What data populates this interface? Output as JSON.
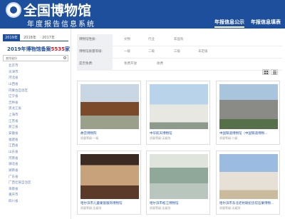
{
  "header": {
    "title": "全国博物馆",
    "subtitle": "年度报告信息系统",
    "tabs": [
      {
        "label": "年报信息公示",
        "active": true
      },
      {
        "label": "年报信息填表",
        "active": false
      }
    ],
    "colors": {
      "brand": "#1e4f9c"
    }
  },
  "sidebar": {
    "year_tabs": [
      {
        "label": "2019年",
        "active": true
      },
      {
        "label": "2018年",
        "active": false
      },
      {
        "label": "2017年",
        "active": false
      }
    ],
    "count_prefix": "2019年博物馆备案",
    "count": "5535",
    "count_suffix": "家",
    "search_placeholder": "查找省份",
    "provinces": [
      "北京市",
      "天津市",
      "河北省",
      "山西省",
      "内蒙古自治区",
      "辽宁省",
      "吉林省",
      "黑龙江省",
      "上海市",
      "江苏省",
      "浙江省",
      "安徽省",
      "福建省",
      "江西省",
      "山东省",
      "河南省",
      "湖北省",
      "湖南省",
      "广东省",
      "广西壮族自治区",
      "海南省",
      "重庆市",
      "四川省"
    ]
  },
  "filters": [
    {
      "label": "博物馆性质:",
      "options": [
        "文物",
        "行业",
        "非国有"
      ]
    },
    {
      "label": "博物馆质量等级:",
      "options": [
        "一级",
        "二级",
        "三级",
        "未定级"
      ]
    },
    {
      "label": "是否免费:",
      "options": [
        "免费开放",
        "收费"
      ]
    }
  ],
  "museums": [
    {
      "name": "故宫博物院",
      "sub": "质量等级:一级"
    },
    {
      "name": "中华航天博物馆",
      "sub": "质量等级:无级别"
    },
    {
      "name": "中国铁道博物馆（中国铁道博物...",
      "sub": "质量等级:二级"
    },
    {
      "name": "哈尔滨市儿童蒙族服饰博物馆",
      "sub": "质量等级:无级别"
    },
    {
      "name": "哈尔滨市松江博物馆",
      "sub": "质量等级:无级别"
    },
    {
      "name": "哈尔滨市东北老抗联纪念馆石蒙博物...",
      "sub": "质量等级:无级别"
    }
  ]
}
